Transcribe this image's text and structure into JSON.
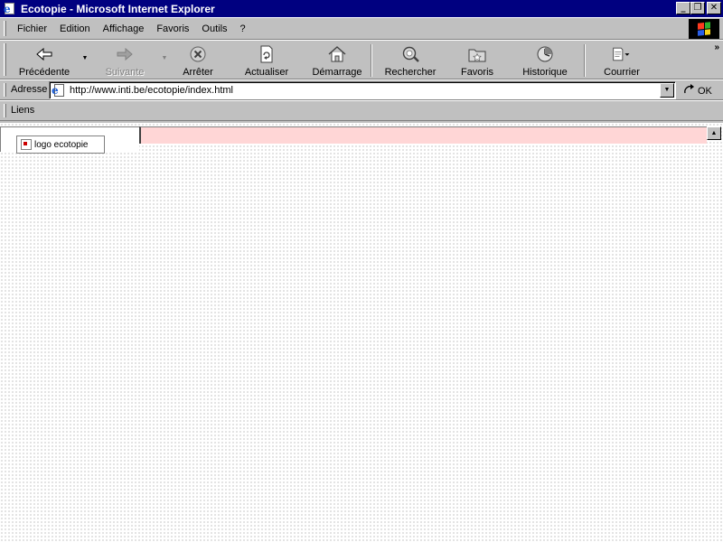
{
  "window": {
    "title": "Ecotopie - Microsoft Internet Explorer",
    "minimize": "_",
    "maximize": "❐",
    "close": "✕"
  },
  "menu": {
    "items": [
      {
        "label": "Fichier"
      },
      {
        "label": "Edition"
      },
      {
        "label": "Affichage"
      },
      {
        "label": "Favoris"
      },
      {
        "label": "Outils"
      },
      {
        "label": "?"
      }
    ]
  },
  "toolbar": {
    "back": "Précédente",
    "forward": "Suivante",
    "stop": "Arrêter",
    "refresh": "Actualiser",
    "home": "Démarrage",
    "search": "Rechercher",
    "favorites": "Favoris",
    "history": "Historique",
    "mail": "Courrier",
    "more": "»"
  },
  "address": {
    "label": "Adresse",
    "url": "http://www.inti.be/ecotopie/index.html",
    "go": "OK"
  },
  "links": {
    "label": "Liens"
  },
  "content": {
    "image_alt": "logo ecotopie"
  },
  "icons": {
    "back": "back-arrow-icon",
    "forward": "forward-arrow-icon",
    "stop": "stop-icon",
    "refresh": "refresh-icon",
    "home": "home-icon",
    "search": "search-icon",
    "favorites": "favorites-icon",
    "history": "history-icon",
    "mail": "mail-icon"
  },
  "colors": {
    "titlebar": "#000080",
    "chrome": "#c0c0c0",
    "right_frame": "#ffd6d6"
  }
}
